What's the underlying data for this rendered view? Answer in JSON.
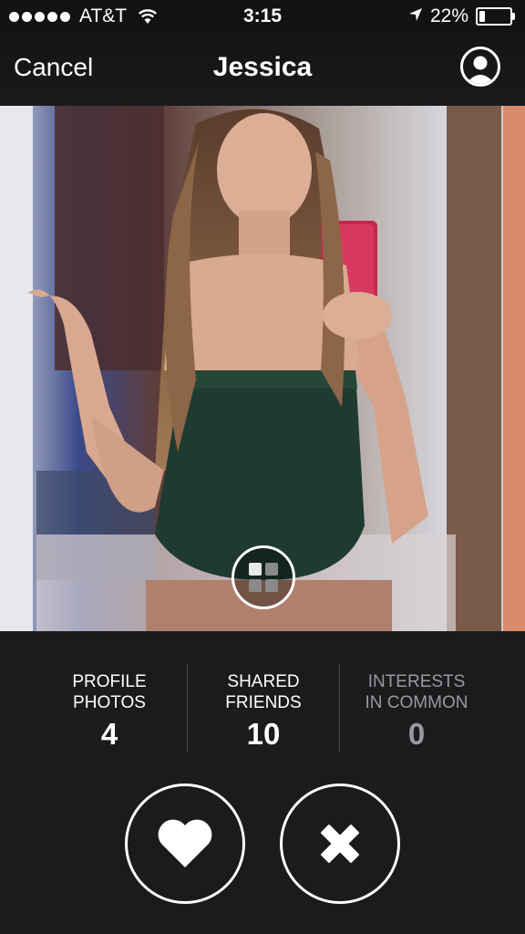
{
  "status_bar": {
    "carrier": "AT&T",
    "time": "3:15",
    "battery_percent": "22%",
    "battery_level": 0.22,
    "signal_bars": 5
  },
  "nav": {
    "cancel_label": "Cancel",
    "title": "Jessica",
    "profile_icon": "person-icon"
  },
  "photo": {
    "gallery_icon": "grid-icon"
  },
  "stats": [
    {
      "label_line1": "PROFILE",
      "label_line2": "PHOTOS",
      "value": "4"
    },
    {
      "label_line1": "SHARED",
      "label_line2": "FRIENDS",
      "value": "10"
    },
    {
      "label_line1": "INTERESTS",
      "label_line2": "IN COMMON",
      "value": "0"
    }
  ],
  "actions": {
    "like_icon": "heart-icon",
    "dismiss_icon": "x-icon"
  },
  "colors": {
    "background": "#1b1b1e",
    "dim_text": "#9a9a9e",
    "accent": "#ffffff"
  }
}
